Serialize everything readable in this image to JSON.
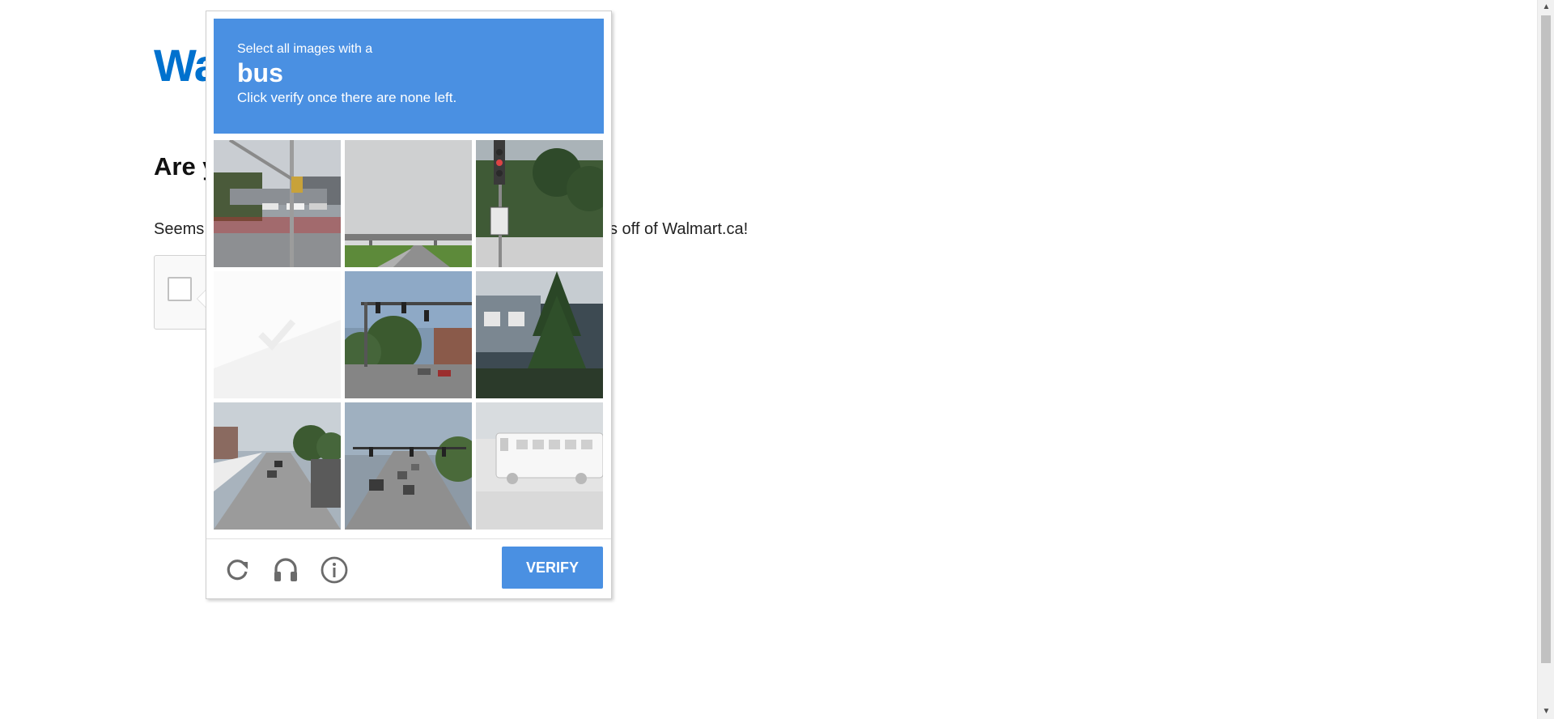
{
  "page": {
    "logo_text": "Wa",
    "heading": "Are y",
    "body_text_start": "Seems",
    "body_text_end": "s off of Walmart.ca!"
  },
  "captcha": {
    "instruction": "Select all images with a",
    "target": "bus",
    "sub_instruction": "Click verify once there are none left.",
    "tiles": [
      {
        "id": 1,
        "state": "default"
      },
      {
        "id": 2,
        "state": "default"
      },
      {
        "id": 3,
        "state": "default"
      },
      {
        "id": 4,
        "state": "fading"
      },
      {
        "id": 5,
        "state": "default"
      },
      {
        "id": 6,
        "state": "default"
      },
      {
        "id": 7,
        "state": "default"
      },
      {
        "id": 8,
        "state": "default"
      },
      {
        "id": 9,
        "state": "fading"
      }
    ],
    "footer": {
      "reload_icon": "reload-icon",
      "audio_icon": "headphones-icon",
      "info_icon": "info-icon",
      "verify_label": "VERIFY"
    }
  },
  "colors": {
    "banner": "#4a90e2",
    "logo": "#0071ce"
  }
}
